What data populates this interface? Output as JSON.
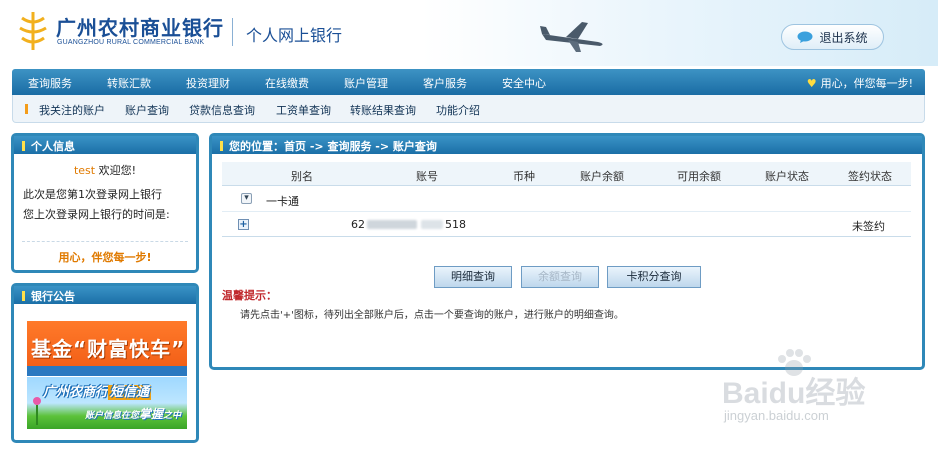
{
  "header": {
    "bank_name_cn": "广州农村商业银行",
    "bank_name_en": "GUANGZHOU RURAL COMMERCIAL BANK",
    "system_title": "个人网上银行",
    "logout_label": "退出系统"
  },
  "nav": {
    "items": [
      "查询服务",
      "转账汇款",
      "投资理财",
      "在线缴费",
      "账户管理",
      "客户服务",
      "安全中心"
    ],
    "slogan": "用心，伴您每一步!"
  },
  "subnav": {
    "items": [
      "我关注的账户",
      "账户查询",
      "贷款信息查询",
      "工资单查询",
      "转账结果查询",
      "功能介绍"
    ]
  },
  "personal_info": {
    "title": "个人信息",
    "username": "test",
    "welcome": "欢迎您!",
    "login_count": "此次是您第1次登录网上银行",
    "last_login": "您上次登录网上银行的时间是:",
    "motto": "用心，伴您每一步!"
  },
  "announcements": {
    "title": "银行公告",
    "ad1_text": "基金“财富快车”",
    "ad2_title_a": "广州农商行",
    "ad2_title_b": "短信通",
    "ad2_sub_a": "账户信息在您",
    "ad2_sub_b": "掌握",
    "ad2_sub_c": "之中"
  },
  "main": {
    "location": "您的位置：首页 -> 查询服务 -> 账户查询",
    "columns": [
      "别名",
      "账号",
      "币种",
      "账户余额",
      "可用余额",
      "账户状态",
      "签约状态"
    ],
    "group": {
      "toggle": "▾",
      "name": "一卡通"
    },
    "account": {
      "expand": "+",
      "no_prefix": "62",
      "no_suffix": "518",
      "sign_status": "未签约"
    },
    "buttons": {
      "detail": "明细查询",
      "balance": "余额查询",
      "points": "卡积分查询"
    },
    "tip_title": "温馨提示：",
    "tip_text": "请先点击'+'图标，待列出全部账户后，点击一个要查询的账户，进行账户的明细查询。"
  },
  "watermark": {
    "brand": "Baidu经验",
    "url": "jingyan.baidu.com"
  },
  "colors": {
    "nav_blue": "#1a6ca4",
    "brand_blue": "#1a4f96",
    "accent_orange": "#e07a00",
    "tip_red": "#c0282c"
  }
}
